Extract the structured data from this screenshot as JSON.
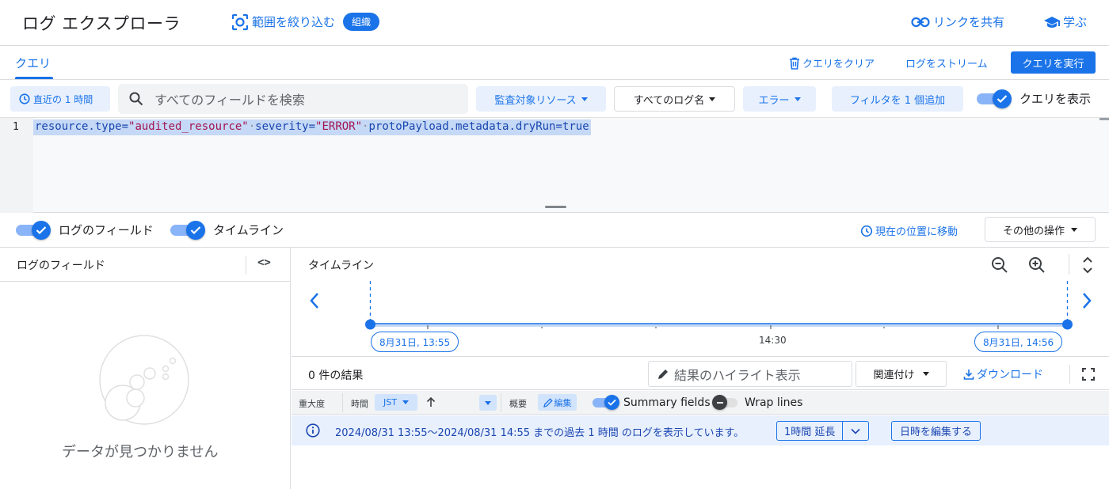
{
  "header": {
    "app_title": "ログ エクスプローラ",
    "scope_label": "範囲を絞り込む",
    "org_chip": "組織",
    "share_link": "リンクを共有",
    "learn": "学ぶ"
  },
  "query_bar": {
    "tab_label": "クエリ",
    "clear_query": "クエリをクリア",
    "stream_logs": "ログをストリーム",
    "run_query": "クエリを実行"
  },
  "filters": {
    "time_range": "直近の 1 時間",
    "search_placeholder": "すべてのフィールドを検索",
    "resource": "監査対象リソース",
    "log_name": "すべてのログ名",
    "severity": "エラー",
    "add_filter": "フィルタを 1 個追加",
    "show_query": "クエリを表示",
    "show_query_enabled": true
  },
  "editor": {
    "line_number": "1",
    "code_parts": {
      "p1": "resource.type=",
      "p2": "\"audited_resource\"",
      "p3": "·",
      "p4": "severity=",
      "p5": "\"ERROR\"",
      "p6": "·",
      "p7": "protoPayload.metadata.dryRun=true"
    }
  },
  "panels": {
    "log_fields_toggle": "ログのフィールド",
    "timeline_toggle": "タイムライン",
    "jump_to_now": "現在の位置に移動",
    "more_actions": "その他の操作"
  },
  "log_fields_panel": {
    "title": "ログのフィールド",
    "empty_text": "データが見つかりません"
  },
  "timeline": {
    "title": "タイムライン",
    "start_label": "8月31日, 13:55",
    "mid_label": "14:30",
    "end_label": "8月31日, 14:56"
  },
  "results": {
    "count": "0 件の結果",
    "highlight_placeholder": "結果のハイライト表示",
    "correlate": "関連付け",
    "download": "ダウンロード"
  },
  "columns": {
    "severity": "重大度",
    "time": "時間",
    "timezone": "JST",
    "summary": "概要",
    "edit": "編集",
    "summary_fields": "Summary fields",
    "summary_fields_enabled": true,
    "wrap_lines": "Wrap lines",
    "wrap_lines_enabled": false
  },
  "info_row": {
    "message": "2024/08/31 13:55〜2024/08/31 14:55 までの過去 1 時間 のログを表示しています。",
    "extend_button": "1時間 延長",
    "edit_datetime": "日時を編集する"
  },
  "colors": {
    "accent": "#1a73e8",
    "accent_light": "#e8f0fe",
    "code_highlight": "#c5d9f6",
    "string_literal": "#a31551"
  }
}
